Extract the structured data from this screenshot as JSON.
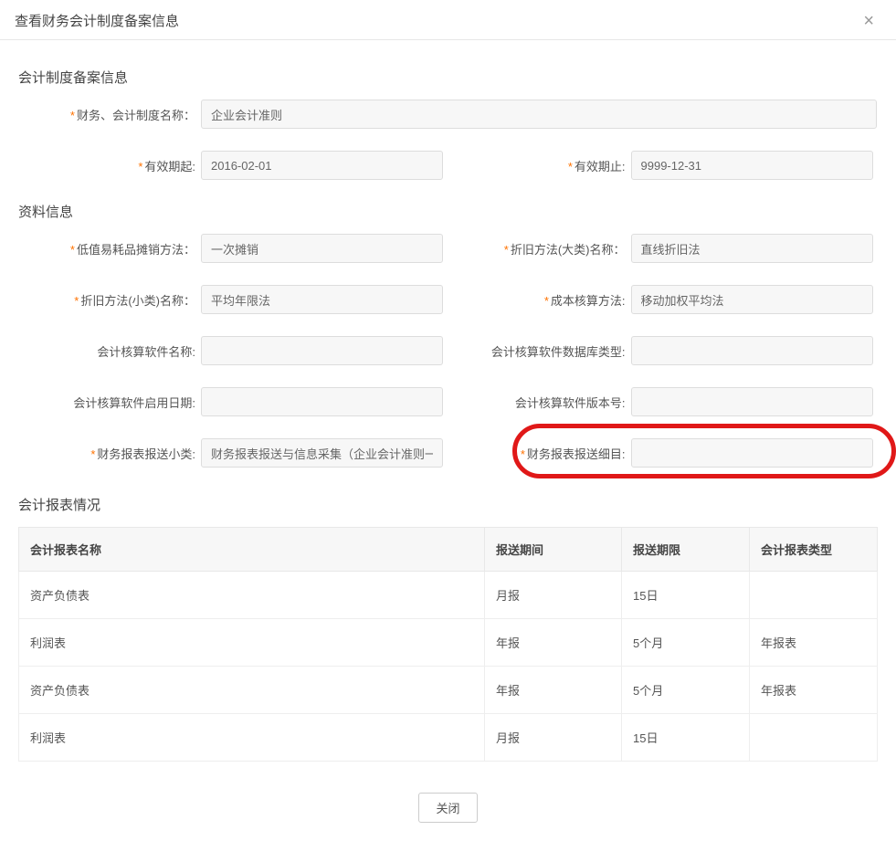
{
  "modal": {
    "title": "查看财务会计制度备案信息",
    "close_glyph": "×",
    "close_label": "关闭"
  },
  "section_filing": {
    "title": "会计制度备案信息",
    "fields": {
      "accounting_system_name": {
        "label": "财务、会计制度名称：",
        "value": "企业会计准则",
        "required": true
      },
      "valid_from": {
        "label": "有效期起:",
        "value": "2016-02-01",
        "required": true
      },
      "valid_to": {
        "label": "有效期止:",
        "value": "9999-12-31",
        "required": true
      }
    }
  },
  "section_material": {
    "title": "资料信息",
    "fields": {
      "low_value_amort": {
        "label": "低值易耗品摊销方法：",
        "value": "一次摊销",
        "required": true
      },
      "dep_major_name": {
        "label": "折旧方法(大类)名称：",
        "value": "直线折旧法",
        "required": true
      },
      "dep_minor_name": {
        "label": "折旧方法(小类)名称：",
        "value": "平均年限法",
        "required": true
      },
      "cost_method": {
        "label": "成本核算方法:",
        "value": "移动加权平均法",
        "required": true
      },
      "acct_software": {
        "label": "会计核算软件名称:",
        "value": "",
        "required": false
      },
      "acct_db_type": {
        "label": "会计核算软件数据库类型:",
        "value": "",
        "required": false
      },
      "acct_enable_date": {
        "label": "会计核算软件启用日期:",
        "value": "",
        "required": false
      },
      "acct_version": {
        "label": "会计核算软件版本号:",
        "value": "",
        "required": false
      },
      "report_subclass": {
        "label": "财务报表报送小类:",
        "value": "财务报表报送与信息采集（企业会计准则一般企⋯",
        "required": true
      },
      "report_detail": {
        "label": "财务报表报送细目:",
        "value": "",
        "required": true
      }
    }
  },
  "section_reports": {
    "title": "会计报表情况",
    "columns": [
      "会计报表名称",
      "报送期间",
      "报送期限",
      "会计报表类型"
    ],
    "rows": [
      {
        "name": "资产负债表",
        "period": "月报",
        "deadline": "15日",
        "type": ""
      },
      {
        "name": "利润表",
        "period": "年报",
        "deadline": "5个月",
        "type": "年报表"
      },
      {
        "name": "资产负债表",
        "period": "年报",
        "deadline": "5个月",
        "type": "年报表"
      },
      {
        "name": "利润表",
        "period": "月报",
        "deadline": "15日",
        "type": ""
      }
    ]
  }
}
